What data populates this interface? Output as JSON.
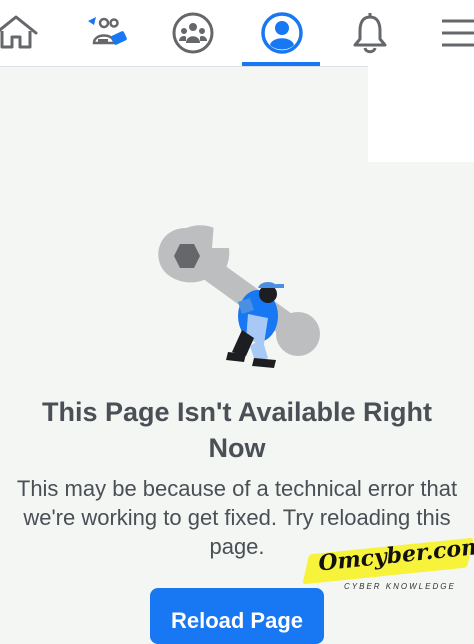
{
  "nav": {
    "tabs": [
      {
        "icon": "home-icon",
        "active": false
      },
      {
        "icon": "friends-icon",
        "active": false
      },
      {
        "icon": "groups-icon",
        "active": false
      },
      {
        "icon": "profile-icon",
        "active": true
      },
      {
        "icon": "bell-icon",
        "active": false
      },
      {
        "icon": "menu-icon",
        "active": false
      }
    ],
    "active_color": "#1877f2",
    "icon_color": "#65676b"
  },
  "error": {
    "illustration_icon": "wrench-mechanic-illustration",
    "title": "This Page Isn't Available Right Now",
    "message": "This may be because of a technical error that we're working to get fixed. Try reloading this page.",
    "reload_label": "Reload Page"
  },
  "watermark": {
    "text": "Omcyber.com",
    "subtext": "CYBER KNOWLEDGE",
    "highlight_color": "#f7f23a"
  }
}
